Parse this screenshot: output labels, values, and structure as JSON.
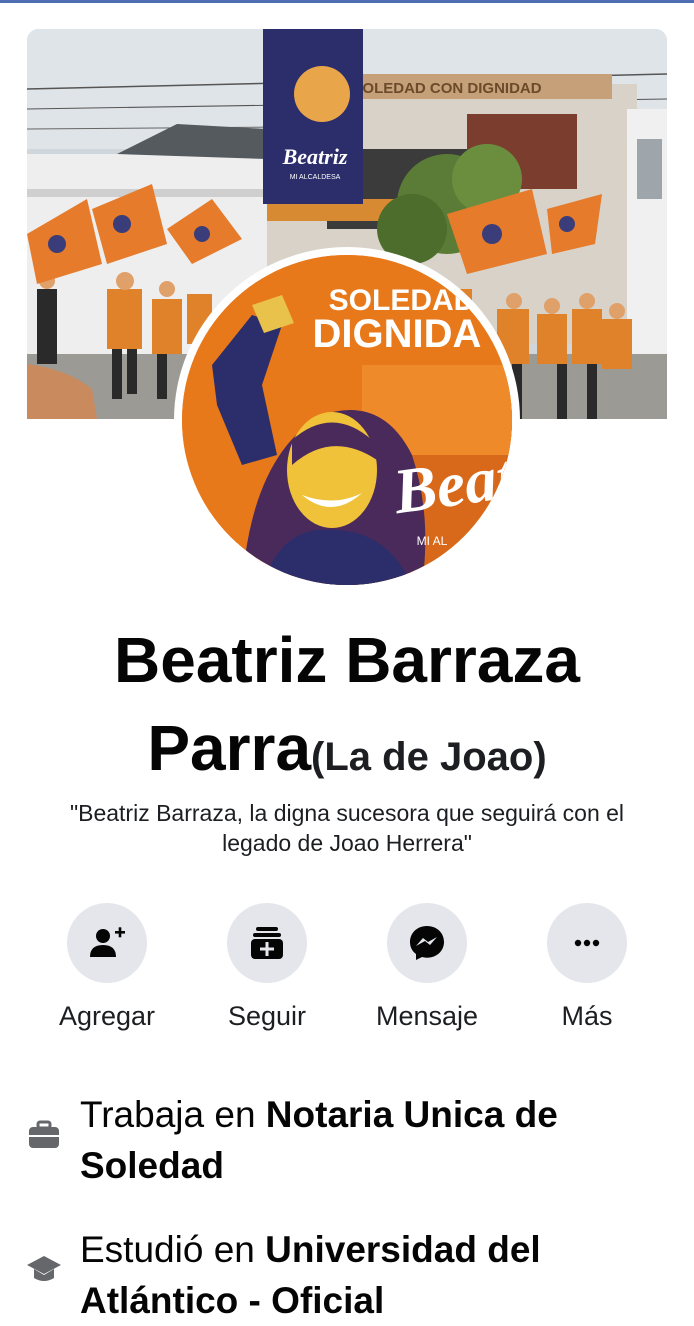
{
  "profile": {
    "name_line1": "Beatriz Barraza",
    "name_line2": "Parra",
    "nickname": "(La de Joao)",
    "bio": "\"Beatriz Barraza, la digna sucesora que seguirá con el legado de Joao Herrera\""
  },
  "cover": {
    "banner_text": "SOLEDAD CON DIGNIDAD",
    "poster_name": "Beatriz",
    "poster_sub": "MI ALCALDESA"
  },
  "avatar_art": {
    "line1": "SOLEDAD",
    "line2": "DIGNIDA",
    "signature": "Beat",
    "sub": "MI AL"
  },
  "actions": [
    {
      "label": "Agregar",
      "icon": "add-friend-icon"
    },
    {
      "label": "Seguir",
      "icon": "follow-icon"
    },
    {
      "label": "Mensaje",
      "icon": "messenger-icon"
    },
    {
      "label": "Más",
      "icon": "more-icon"
    }
  ],
  "intro": {
    "work_prefix": "Trabaja en ",
    "work_place": "Notaria Unica de Soledad",
    "study_prefix": "Estudió en ",
    "study_place": "Universidad del Atlántico - Oficial"
  },
  "colors": {
    "accent": "#1877f2",
    "button_bg": "#e4e6eb",
    "campaign_orange": "#e8791a",
    "campaign_navy": "#2b2e6b"
  }
}
